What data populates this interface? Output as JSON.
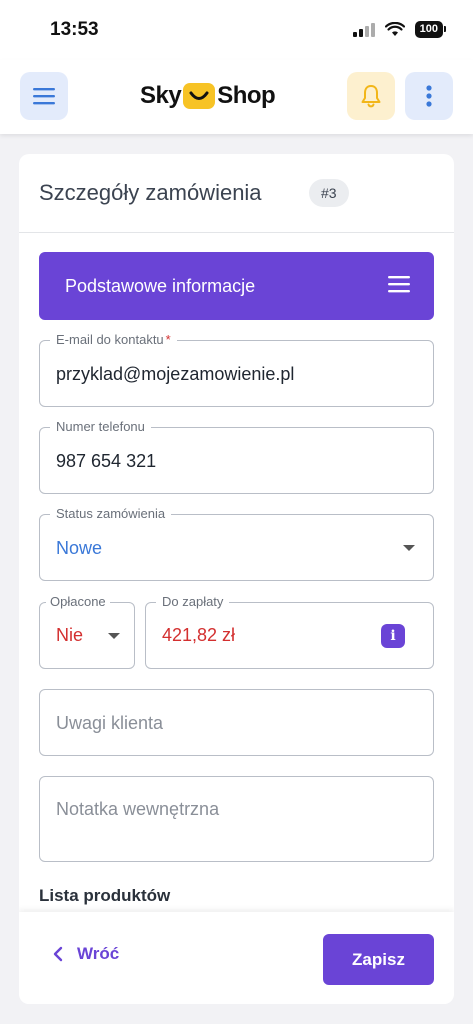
{
  "status_bar": {
    "time": "13:53",
    "battery": "100"
  },
  "header": {
    "logo_left": "Sky",
    "logo_right": "Shop"
  },
  "card": {
    "title": "Szczegóły zamówienia",
    "order_badge": "#3",
    "section_title": "Podstawowe informacje"
  },
  "form": {
    "email": {
      "label": "E-mail do kontaktu",
      "required_mark": "*",
      "value": "przyklad@mojezamowienie.pl"
    },
    "phone": {
      "label": "Numer telefonu",
      "value": "987 654 321"
    },
    "status": {
      "label": "Status zamówienia",
      "value": "Nowe"
    },
    "paid": {
      "label": "Opłacone",
      "value": "Nie"
    },
    "due": {
      "label": "Do zapłaty",
      "value": "421,82 zł",
      "info": "i"
    },
    "customer_notes": {
      "placeholder": "Uwagi klienta"
    },
    "internal_note": {
      "placeholder": "Notatka wewnętrzna"
    }
  },
  "products": {
    "label": "Lista produktów"
  },
  "footer": {
    "back_label": "Wróć",
    "save_label": "Zapisz"
  },
  "colors": {
    "accent": "#6a44d6",
    "status_value": "#3a78d8",
    "negative": "#d32f2f",
    "bell": "#f2b619",
    "logo_yellow": "#f7c325"
  }
}
